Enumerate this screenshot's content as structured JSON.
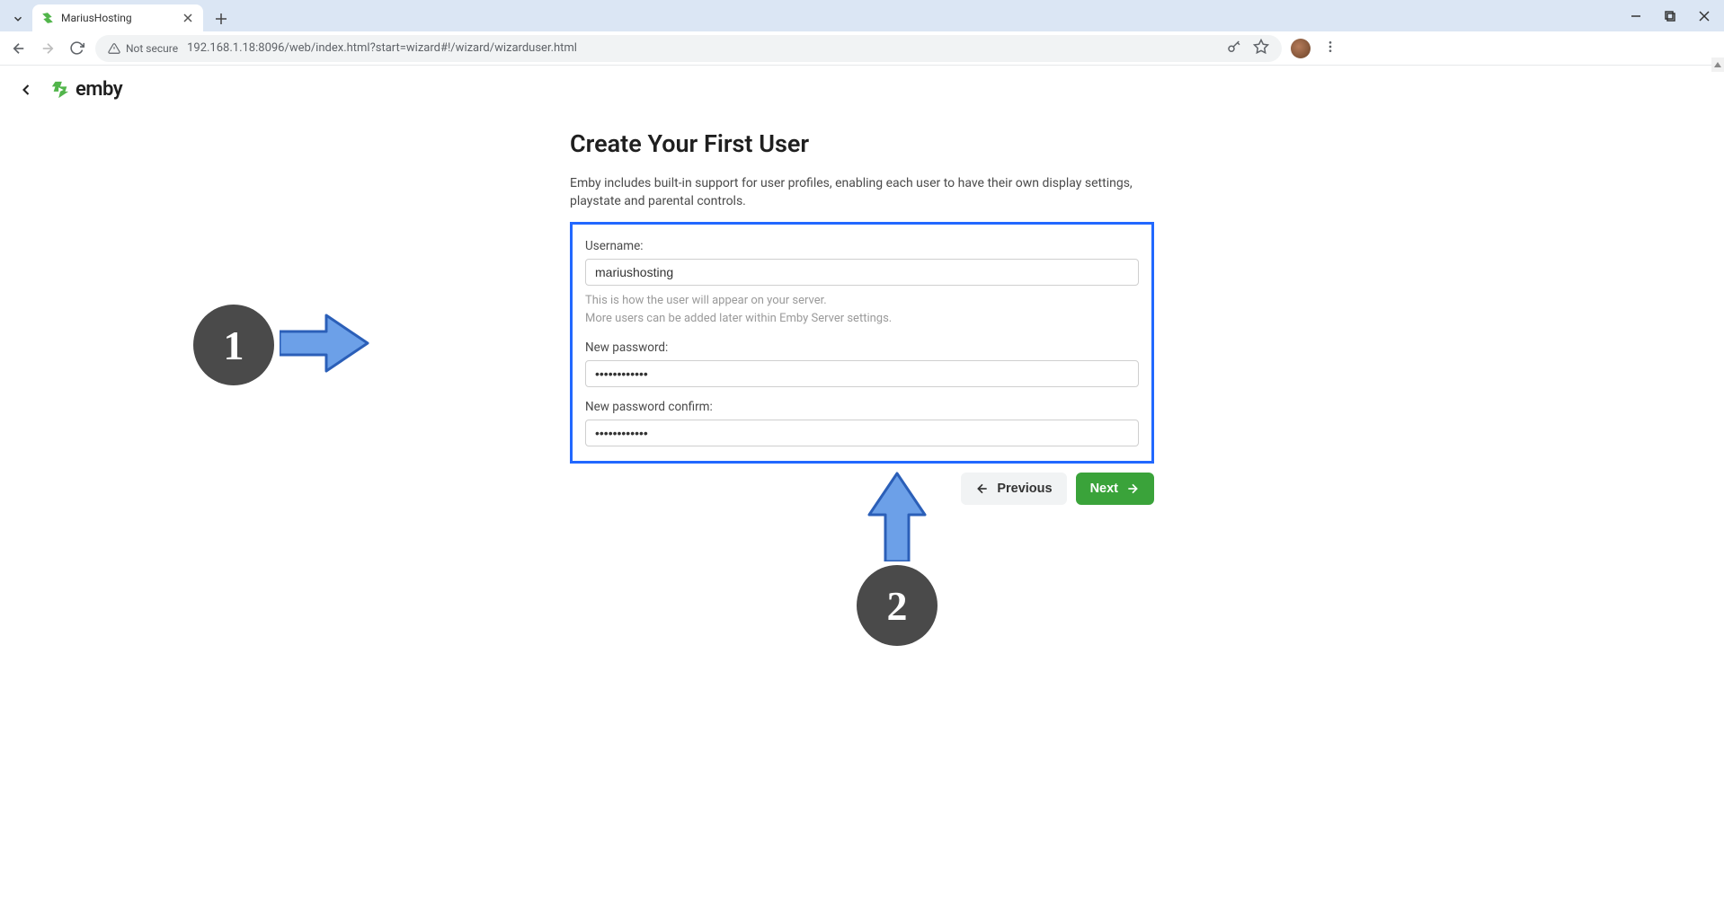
{
  "browser": {
    "tab_title": "MariusHosting",
    "url": "192.168.1.18:8096/web/index.html?start=wizard#!/wizard/wizarduser.html",
    "security_label": "Not secure"
  },
  "page": {
    "heading": "Create Your First User",
    "description": "Emby includes built-in support for user profiles, enabling each user to have their own display settings, playstate and parental controls.",
    "logo_text": "emby"
  },
  "form": {
    "username_label": "Username:",
    "username_value": "mariushosting",
    "helper1": "This is how the user will appear on your server.",
    "helper2": "More users can be added later within Emby Server settings.",
    "password_label": "New password:",
    "password_value": "••••••••••••",
    "confirm_label": "New password confirm:",
    "confirm_value": "••••••••••••"
  },
  "buttons": {
    "previous": "Previous",
    "next": "Next"
  },
  "callouts": {
    "one": "1",
    "two": "2"
  }
}
